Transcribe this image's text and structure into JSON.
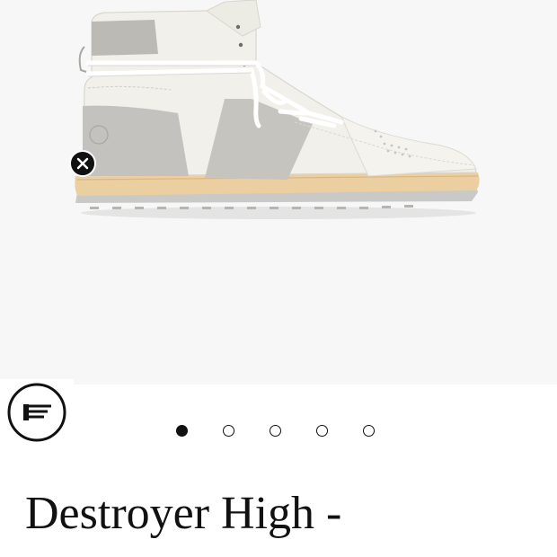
{
  "product": {
    "title": "Destroyer High -"
  },
  "gallery": {
    "image_count": 5,
    "active_index": 0
  },
  "colors": {
    "background": "#ffffff",
    "image_background": "#f7f7f7",
    "text": "#111111",
    "sole": "#eccfa0",
    "suede": "#c4c2be",
    "leather": "#f1f0ea"
  },
  "icons": {
    "close": "close-icon",
    "brand": "brand-logo-icon"
  }
}
